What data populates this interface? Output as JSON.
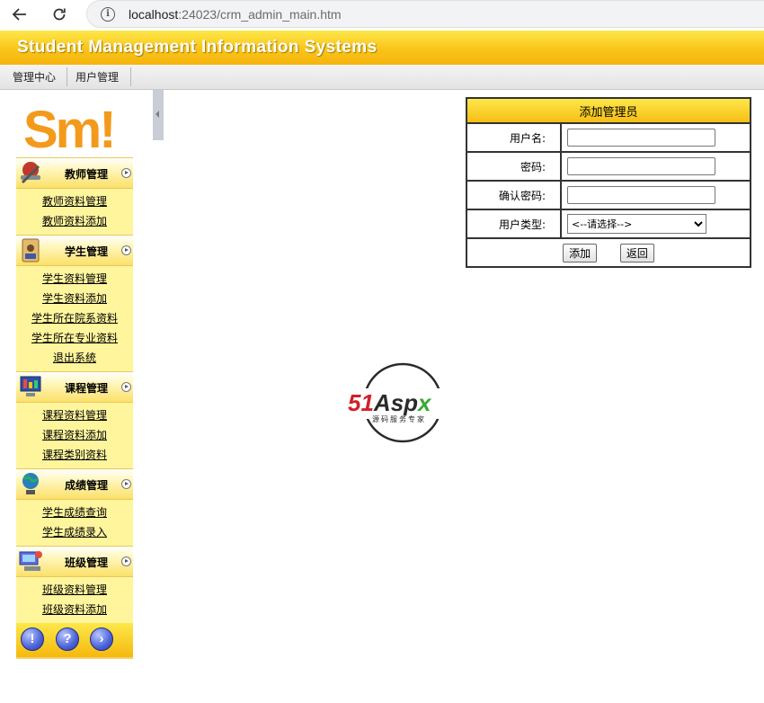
{
  "browser": {
    "url_host": "localhost",
    "url_rest": ":24023/crm_admin_main.htm"
  },
  "banner": {
    "title": "Student Management Information Systems"
  },
  "menubar": {
    "items": [
      "管理中心",
      "用户管理"
    ]
  },
  "logo": {
    "text": "Sm!"
  },
  "sidebar": {
    "groups": [
      {
        "title": "教师管理",
        "icon": "teacher-tools-icon",
        "items": [
          "教师资料管理",
          "教师资料添加"
        ]
      },
      {
        "title": "学生管理",
        "icon": "student-card-icon",
        "items": [
          "学生资料管理",
          "学生资料添加",
          "学生所在院系资料",
          "学生所在专业资料",
          "退出系统"
        ]
      },
      {
        "title": "课程管理",
        "icon": "course-monitor-icon",
        "items": [
          "课程资料管理",
          "课程资料添加",
          "课程类别资料"
        ]
      },
      {
        "title": "成绩管理",
        "icon": "globe-tools-icon",
        "items": [
          "学生成绩查询",
          "学生成绩录入"
        ]
      },
      {
        "title": "班级管理",
        "icon": "class-computer-icon",
        "items": [
          "班级资料管理",
          "班级资料添加"
        ]
      }
    ],
    "footer_buttons": [
      "!",
      "?",
      "›"
    ]
  },
  "watermark": {
    "brand": "51Aspx",
    "tagline": "源码服务专家"
  },
  "form": {
    "title": "添加管理员",
    "username_label": "用户名:",
    "password_label": "密码:",
    "confirm_label": "确认密码:",
    "type_label": "用户类型:",
    "type_selected": "<--请选择-->",
    "add_button": "添加",
    "back_button": "返回"
  },
  "colors": {
    "banner": "#f9c419",
    "sidebar": "#fff59d",
    "accent_red": "#d3202a",
    "accent_green": "#3aa935"
  }
}
